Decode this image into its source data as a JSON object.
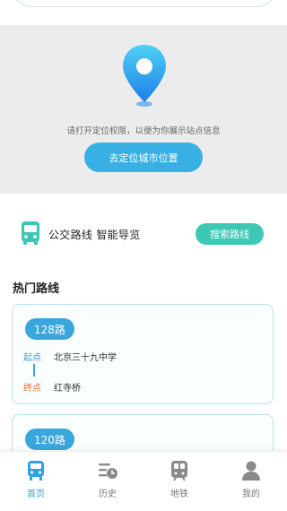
{
  "colors": {
    "primary": "#39b0e4",
    "accent": "#3cc8b4",
    "start_label": "#3a9ccf",
    "end_label": "#e06b2c",
    "tab_active": "#2fa3dd",
    "tab_inactive": "#8a8a8a"
  },
  "location": {
    "icon": "location-pin-icon",
    "hint": "请打开定位权限，以便为你展示站点信息",
    "button": "去定位城市位置"
  },
  "promo": {
    "icon": "bus-icon",
    "text": "公交路线 智能导览",
    "button": "搜索路线"
  },
  "hot_routes": {
    "title": "热门路线",
    "start_label": "起点",
    "end_label": "终点",
    "items": [
      {
        "name": "128路",
        "start": "北京三十九中学",
        "end": "红寺桥"
      },
      {
        "name": "120路"
      }
    ]
  },
  "tabs": [
    {
      "label": "首页",
      "icon": "bus-home-icon",
      "active": true
    },
    {
      "label": "历史",
      "icon": "history-icon",
      "active": false
    },
    {
      "label": "地铁",
      "icon": "subway-icon",
      "active": false
    },
    {
      "label": "我的",
      "icon": "user-icon",
      "active": false
    }
  ]
}
